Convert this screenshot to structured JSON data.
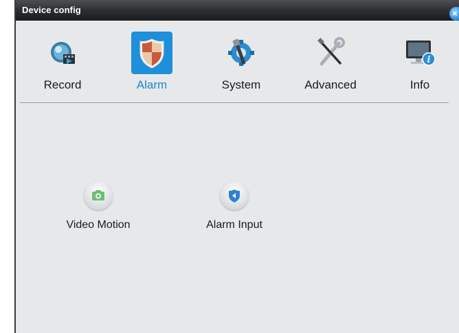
{
  "window": {
    "title": "Device config",
    "close_icon": "close-icon",
    "accent_color": "#1e8fd9"
  },
  "tabs": [
    {
      "label": "Record",
      "icon": "record-icon",
      "selected": false
    },
    {
      "label": "Alarm",
      "icon": "alarm-shield-icon",
      "selected": true
    },
    {
      "label": "System",
      "icon": "system-gear-icon",
      "selected": false
    },
    {
      "label": "Advanced",
      "icon": "advanced-tools-icon",
      "selected": false
    },
    {
      "label": "Info",
      "icon": "info-monitor-icon",
      "selected": false
    }
  ],
  "alarm_items": [
    {
      "label": "Video Motion",
      "icon": "camera-icon"
    },
    {
      "label": "Alarm Input",
      "icon": "alarm-input-icon"
    }
  ]
}
